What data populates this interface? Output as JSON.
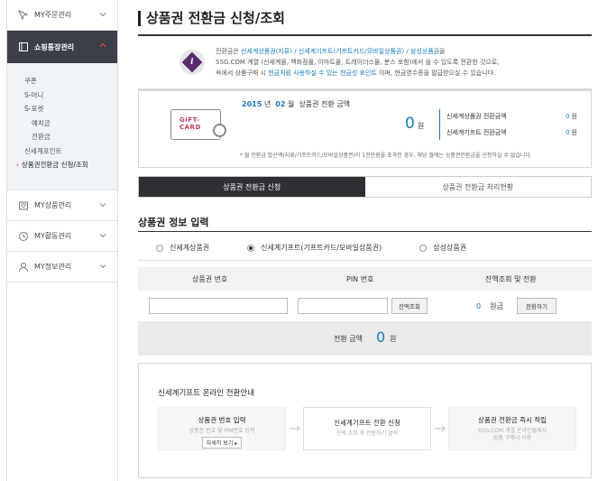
{
  "sidebar": {
    "top_item": "MY주문관리",
    "active": "쇼핑통장관리",
    "sub_items": [
      "쿠폰",
      "S-머니",
      "S-포켓",
      "예치금",
      "전환금",
      "신세계포인트",
      "상품권전환금 신청/조회"
    ],
    "bottom_items": [
      "MY상품관리",
      "MY활동관리",
      "MY정보관리"
    ]
  },
  "page": {
    "title": "상품권 전환금 신청/조회"
  },
  "info": {
    "line1_prefix": "전환금은 ",
    "line1_links": "신세계상품권(지류) / 신세계기프트(기프트카드/모바일상품권) / 삼성상품권",
    "line1_suffix": "을",
    "line2": "SSG.COM 계열 (신세계몰, 백화점몰, 이마트몰, 트레이더스몰, 분스 포함)에서 쓸 수 있도록 전환한 것으로,",
    "line3_prefix": "쓱에서 상품구매 시 ",
    "line3_link": "현금처럼 사용하실 수 있는 현금성 포인트",
    "line3_suffix": " 이며, 현금영수증을 발급받으실 수 있습니다."
  },
  "summary": {
    "card_text_1": "GIFT-",
    "card_text_2": "CARD",
    "year": "2015",
    "year_unit": "년",
    "month": "02",
    "month_unit": "월",
    "date_label": "상품권 전환 금액",
    "total": "0",
    "total_unit": "원",
    "sub1_label": "신세계상품권 전환금액",
    "sub1_value": "0",
    "sub1_unit": "원",
    "sub2_label": "신세계기프트 전환금액",
    "sub2_value": "0",
    "sub2_unit": "원",
    "note": "* 월 전환금 합산액(지류/기프트카드/모바일상품권)이 1천만원을 초과한 경우, 해당 월에는 상품권전환금을 신청하실 수 없습니다."
  },
  "tabs": [
    "상품권 전환금 신청",
    "상품권 전환금 처리현황"
  ],
  "section": {
    "title": "상품권 정보 입력",
    "radios": [
      "신세계상품권",
      "신세계기프트(기프트카드/모바일상품권)",
      "삼성상품권"
    ],
    "selected_radio": 1
  },
  "table": {
    "headers": [
      "상품권 번호",
      "PIN 번호",
      "잔액조회 및 전환"
    ],
    "check_btn": "잔액조회",
    "balance": "0",
    "balance_unit": "원금",
    "convert_btn": "전환하기"
  },
  "conversion": {
    "label": "전환 금액",
    "amount": "0",
    "unit": "원"
  },
  "guide": {
    "title": "신세계기프트 온라인 전환안내",
    "step1_title": "상품권 번호 입력",
    "step1_desc": "상품권 번호 및 PIN번호 입력",
    "step1_more": "자세히 보기 ▸",
    "step2_title": "신세계기프트 전환 신청",
    "step2_desc": "잔액 조회 후 전환하기 클릭",
    "step3_title": "상품권 전환금 즉시 적립",
    "step3_desc1": "SSG.COM 계열 온라인몰에서",
    "step3_desc2": "상품 구매시 사용"
  }
}
